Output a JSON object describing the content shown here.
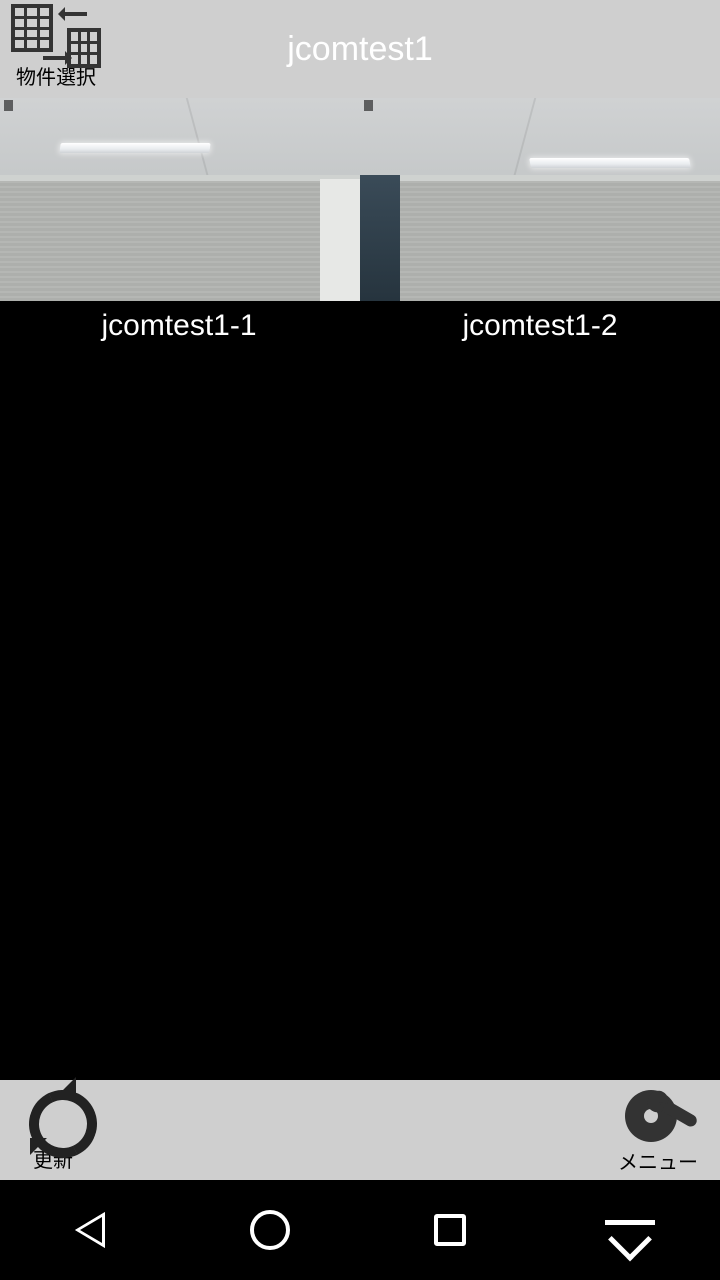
{
  "header": {
    "title": "jcomtest1",
    "property_select_label": "物件選択"
  },
  "cameras": [
    {
      "name": "jcomtest1-1"
    },
    {
      "name": "jcomtest1-2"
    }
  ],
  "toolbar": {
    "refresh_label": "更新",
    "menu_label": "メニュー"
  }
}
